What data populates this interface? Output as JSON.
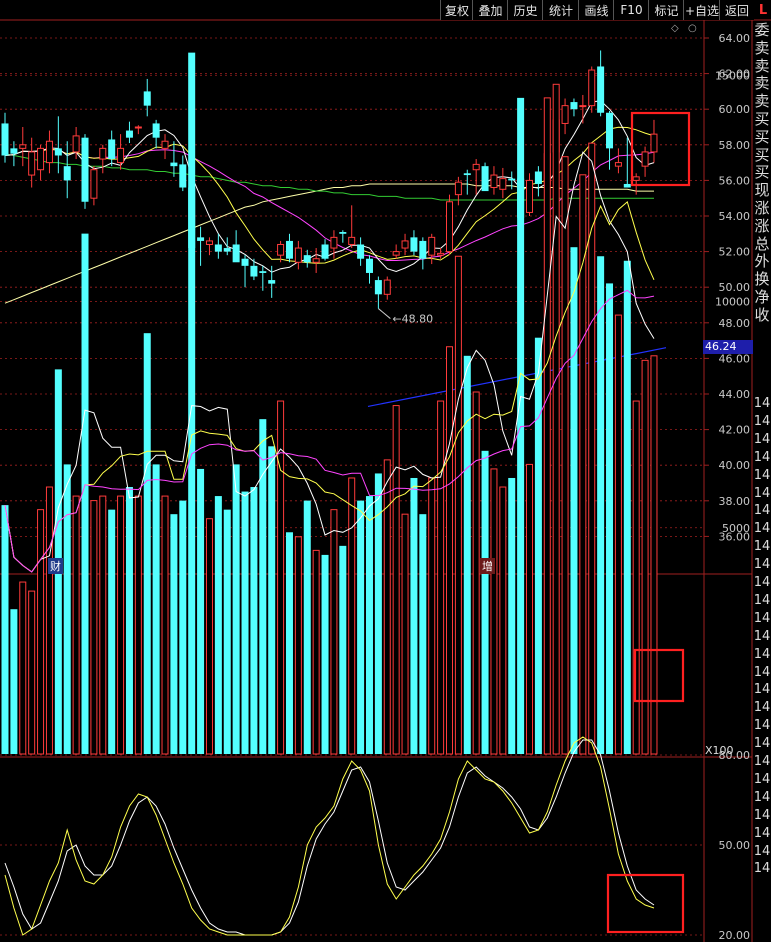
{
  "toolbar": {
    "buttons": [
      {
        "label": "复权"
      },
      {
        "label": "叠加"
      },
      {
        "label": "历史"
      },
      {
        "label": "统计"
      },
      {
        "label": "画线"
      },
      {
        "label": "F10"
      },
      {
        "label": "标记"
      },
      {
        "label": "+自选"
      },
      {
        "label": "返回"
      }
    ],
    "corner_label": "L"
  },
  "side_panel": {
    "chars": [
      "委",
      "卖",
      "卖",
      "卖",
      "卖",
      "买",
      "买",
      "买",
      "买",
      "现",
      "涨",
      "涨",
      "总",
      "外",
      "换",
      "净",
      "收"
    ],
    "repeated_label": "14",
    "repeat_count": 27
  },
  "price_pane": {
    "y_ticks": [
      "64.00",
      "62.00",
      "60.00",
      "58.00",
      "56.00",
      "54.00",
      "52.00",
      "50.00",
      "48.00",
      "46.00",
      "44.00",
      "42.00",
      "40.00",
      "38.00",
      "36.00"
    ],
    "low_label": "48.80",
    "current_value_badge": "46.24",
    "badge_left": "财",
    "badge_right": "增",
    "small_icon": "diamond-icon"
  },
  "volume_pane": {
    "y_ticks": [
      "15000",
      "10000",
      "5000"
    ],
    "unit": "X100"
  },
  "kdj_pane": {
    "y_ticks": [
      "80.00",
      "50.00",
      "20.00"
    ]
  },
  "colors": {
    "up": "#ff3b3b",
    "down": "#54ffff",
    "ma5": "#ffffff",
    "ma10": "#ffff4d",
    "ma20": "#ff44ff",
    "ma60": "#33cc33",
    "ma250": "#ffffaa",
    "longline": "#2233ff",
    "grid": "#a02020",
    "highlight": "#ff2020"
  },
  "chart_data": {
    "type": "candlestick",
    "ohlc": [
      [
        59.2,
        59.8,
        57.0,
        57.4
      ],
      [
        57.8,
        58.2,
        56.8,
        57.5
      ],
      [
        57.8,
        59.0,
        56.8,
        58.0
      ],
      [
        56.3,
        58.4,
        55.6,
        57.6
      ],
      [
        56.6,
        58.0,
        56.0,
        57.8
      ],
      [
        57.0,
        58.8,
        56.4,
        58.2
      ],
      [
        57.8,
        59.6,
        56.4,
        57.4
      ],
      [
        56.8,
        58.2,
        55.0,
        56.0
      ],
      [
        57.6,
        59.0,
        57.2,
        58.5
      ],
      [
        58.4,
        58.6,
        54.4,
        54.8
      ],
      [
        55.0,
        56.8,
        54.6,
        56.6
      ],
      [
        57.2,
        58.0,
        56.4,
        57.8
      ],
      [
        58.3,
        58.8,
        56.8,
        57.2
      ],
      [
        57.0,
        58.6,
        56.6,
        57.8
      ],
      [
        58.8,
        59.3,
        58.1,
        58.4
      ],
      [
        59.0,
        59.1,
        58.6,
        59.0
      ],
      [
        61.0,
        61.7,
        59.6,
        60.2
      ],
      [
        59.2,
        59.4,
        57.8,
        58.4
      ],
      [
        57.8,
        58.6,
        57.2,
        58.2
      ],
      [
        57.0,
        58.2,
        56.2,
        56.8
      ],
      [
        56.9,
        57.4,
        55.4,
        55.6
      ],
      [
        55.6,
        55.6,
        51.6,
        52.2
      ],
      [
        52.8,
        53.4,
        51.2,
        52.6
      ],
      [
        52.4,
        52.8,
        51.8,
        52.6
      ],
      [
        52.4,
        53.0,
        51.6,
        52.0
      ],
      [
        52.2,
        52.8,
        51.8,
        52.0
      ],
      [
        52.4,
        53.2,
        51.6,
        51.4
      ],
      [
        51.6,
        51.8,
        50.0,
        51.2
      ],
      [
        51.2,
        51.6,
        50.4,
        50.6
      ],
      [
        50.9,
        51.2,
        49.8,
        50.8
      ],
      [
        50.4,
        51.2,
        49.4,
        50.2
      ],
      [
        51.8,
        52.6,
        51.4,
        52.4
      ],
      [
        52.6,
        53.0,
        51.4,
        51.6
      ],
      [
        51.4,
        52.6,
        51.0,
        52.2
      ],
      [
        51.8,
        52.1,
        51.1,
        51.4
      ],
      [
        51.4,
        52.2,
        50.8,
        51.6
      ],
      [
        52.4,
        52.7,
        51.5,
        51.6
      ],
      [
        52.2,
        53.2,
        51.6,
        52.8
      ],
      [
        53.1,
        53.2,
        52.5,
        53.0
      ],
      [
        52.4,
        54.6,
        52.2,
        52.8
      ],
      [
        52.4,
        52.8,
        51.2,
        51.6
      ],
      [
        51.6,
        51.8,
        50.2,
        50.8
      ],
      [
        50.4,
        50.6,
        48.8,
        49.6
      ],
      [
        49.6,
        50.6,
        49.3,
        50.4
      ],
      [
        51.8,
        52.4,
        51.6,
        52.0
      ],
      [
        52.2,
        53.0,
        51.8,
        52.6
      ],
      [
        52.8,
        53.2,
        51.8,
        52.0
      ],
      [
        52.6,
        52.8,
        51.0,
        51.6
      ],
      [
        51.8,
        53.0,
        51.3,
        52.8
      ],
      [
        51.8,
        52.2,
        51.6,
        51.9
      ],
      [
        52.0,
        55.2,
        51.8,
        54.8
      ],
      [
        55.2,
        56.2,
        54.6,
        55.9
      ],
      [
        56.4,
        56.6,
        55.2,
        56.3
      ],
      [
        56.6,
        57.2,
        55.2,
        56.9
      ],
      [
        56.8,
        57.0,
        55.6,
        55.4
      ],
      [
        55.6,
        56.8,
        55.2,
        56.3
      ],
      [
        55.5,
        56.7,
        55.0,
        56.1
      ],
      [
        56.1,
        56.5,
        55.5,
        56.0
      ],
      [
        56.1,
        56.3,
        53.2,
        53.9
      ],
      [
        54.2,
        56.4,
        54.0,
        56.0
      ],
      [
        56.5,
        56.8,
        55.1,
        55.8
      ],
      [
        55.8,
        57.8,
        55.6,
        57.5
      ],
      [
        57.6,
        60.0,
        57.0,
        59.4
      ],
      [
        59.2,
        60.6,
        58.6,
        60.2
      ],
      [
        60.4,
        60.6,
        59.6,
        60.0
      ],
      [
        60.2,
        60.8,
        59.2,
        60.2
      ],
      [
        60.2,
        62.4,
        59.8,
        62.2
      ],
      [
        62.4,
        63.3,
        59.6,
        59.8
      ],
      [
        59.8,
        59.9,
        56.6,
        57.8
      ],
      [
        56.8,
        57.8,
        56.4,
        57.0
      ],
      [
        55.8,
        58.4,
        55.6,
        55.6
      ],
      [
        56.0,
        56.4,
        55.2,
        56.2
      ],
      [
        56.8,
        57.9,
        56.2,
        57.6
      ],
      [
        57.6,
        59.4,
        57.0,
        58.6
      ]
    ],
    "volume": [
      5500,
      3200,
      3800,
      3600,
      5400,
      5900,
      8500,
      6400,
      5700,
      11500,
      5600,
      5700,
      5400,
      5700,
      5900,
      5700,
      9300,
      6400,
      5700,
      5300,
      5600,
      15500,
      6300,
      5200,
      5700,
      5400,
      6400,
      5800,
      5900,
      7400,
      6800,
      7800,
      4900,
      4800,
      5600,
      4500,
      4400,
      5400,
      4600,
      6100,
      5600,
      5700,
      6200,
      6500,
      7700,
      5300,
      6100,
      5300,
      6100,
      7800,
      9000,
      11000,
      8800,
      8000,
      6700,
      6300,
      5900,
      6100,
      14500,
      6400,
      9200,
      14500,
      14800,
      13200,
      11200,
      12800,
      13500,
      11000,
      10400,
      9700,
      10900,
      7800,
      8700,
      8800
    ],
    "ma250": [
      49.1,
      49.3,
      49.5,
      49.7,
      49.9,
      50.1,
      50.3,
      50.5,
      50.7,
      50.9,
      51.1,
      51.3,
      51.5,
      51.7,
      51.9,
      52.1,
      52.3,
      52.5,
      52.7,
      52.9,
      53.1,
      53.3,
      53.5,
      53.7,
      53.9,
      54.1,
      54.3,
      54.5,
      54.6,
      54.8,
      54.9,
      55.0,
      55.1,
      55.2,
      55.3,
      55.4,
      55.5,
      55.6,
      55.6,
      55.7,
      55.7,
      55.8,
      55.8,
      55.8,
      55.8,
      55.8,
      55.8,
      55.8,
      55.8,
      55.8,
      55.8,
      55.8,
      55.8,
      55.7,
      55.7,
      55.7,
      55.7,
      55.7,
      55.6,
      55.6,
      55.6,
      55.6,
      55.6,
      55.5,
      55.5,
      55.5,
      55.5,
      55.5,
      55.5,
      55.5,
      55.5,
      55.4,
      55.4,
      55.4
    ],
    "ma60": [
      57.5,
      57.4,
      57.3,
      57.2,
      57.1,
      57.0,
      57.0,
      56.9,
      56.9,
      56.8,
      56.8,
      56.8,
      56.7,
      56.7,
      56.6,
      56.6,
      56.6,
      56.5,
      56.5,
      56.4,
      56.4,
      56.3,
      56.2,
      56.2,
      56.1,
      56.0,
      55.9,
      55.9,
      55.8,
      55.7,
      55.7,
      55.6,
      55.6,
      55.5,
      55.5,
      55.4,
      55.4,
      55.3,
      55.3,
      55.2,
      55.2,
      55.2,
      55.1,
      55.1,
      55.1,
      55.0,
      55.0,
      55.0,
      55.0,
      54.9,
      54.9,
      54.9,
      54.9,
      54.9,
      54.9,
      54.9,
      54.9,
      54.9,
      54.9,
      54.9,
      54.9,
      54.9,
      55.0,
      55.0,
      55.0,
      55.0,
      55.0,
      55.0,
      55.0,
      55.0,
      55.0,
      55.0,
      55.0,
      55.0
    ],
    "kdj_k": [
      40,
      29,
      20,
      22,
      30,
      38,
      44,
      55,
      45,
      38,
      37,
      40,
      46,
      56,
      63,
      67,
      66,
      60,
      52,
      44,
      37,
      29,
      25,
      22,
      21,
      20,
      20,
      20,
      20,
      20,
      20,
      21,
      26,
      36,
      50,
      56,
      59,
      63,
      72,
      78,
      75,
      68,
      50,
      37,
      32,
      36,
      40,
      43,
      47,
      52,
      61,
      72,
      78,
      75,
      72,
      71,
      68,
      64,
      59,
      54,
      55,
      61,
      70,
      78,
      84,
      86,
      84,
      76,
      62,
      47,
      38,
      32,
      30,
      29
    ],
    "kdj_d": [
      44,
      36,
      27,
      22,
      24,
      31,
      38,
      48,
      50,
      43,
      40,
      40,
      43,
      50,
      58,
      64,
      66,
      63,
      57,
      49,
      42,
      35,
      29,
      24,
      22,
      21,
      21,
      20,
      20,
      20,
      20,
      21,
      24,
      31,
      43,
      52,
      57,
      61,
      68,
      75,
      76,
      71,
      58,
      44,
      36,
      35,
      38,
      41,
      45,
      49,
      56,
      66,
      74,
      76,
      73,
      71,
      69,
      66,
      62,
      56,
      55,
      59,
      66,
      74,
      81,
      85,
      85,
      80,
      68,
      54,
      43,
      35,
      32,
      30
    ],
    "longline": {
      "from": 43.3,
      "to": 46.6
    }
  }
}
